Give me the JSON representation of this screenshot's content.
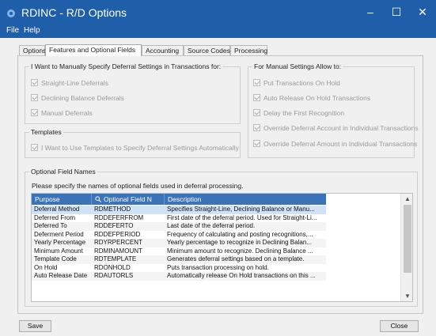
{
  "window": {
    "title": "RDINC - R/D Options",
    "controls": {
      "minimize": "–",
      "maximize": "☐",
      "close": "✕"
    }
  },
  "menu": [
    "File",
    "Help"
  ],
  "tabs": [
    "Options",
    "Features and Optional Fields",
    "Accounting",
    "Source Codes",
    "Processing"
  ],
  "active_tab": "Features and Optional Fields",
  "manual_group": {
    "title": "I Want to Manually Specify Deferral Settings in Transactions for:",
    "items": [
      "Straight-Line Deferrals",
      "Declining Balance Deferrals",
      "Manual Deferrals"
    ]
  },
  "templates_group": {
    "title": "Templates",
    "items": [
      "I Want to Use Templates to Specify Deferral Settings Automatically"
    ]
  },
  "allow_group": {
    "title": "For Manual Settings Allow to:",
    "items": [
      "Put Transactions On Hold",
      "Auto Release On Hold Transactions",
      "Delay the First Recognition",
      "Override Deferral Account in Individual Transactions",
      "Override Deferral Amount in Individual Transactions"
    ]
  },
  "optional_fields": {
    "title": "Optional Field Names",
    "intro": "Please specify the names of optional fields used in deferral processing.",
    "columns": [
      "Purpose",
      "Optional Field N",
      "Description"
    ],
    "rows": [
      [
        "Deferral Method",
        "RDMETHOD",
        "Specifies Straight-Line, Declining Balance or Manu..."
      ],
      [
        "Deferred From",
        "RDDEFERFROM",
        "First date of the deferral period. Used for Straight-Li..."
      ],
      [
        "Deferred To",
        "RDDEFERTO",
        "Last date of the deferral period."
      ],
      [
        "Deferment Period",
        "RDDEFPERIOD",
        "Frequency of calculating and posting recognitions,..."
      ],
      [
        "Yearly Percentage",
        "RDYRPERCENT",
        "Yearly percentage to recognize in Declining Balan..."
      ],
      [
        "Minimum Amount",
        "RDMINAMOUNT",
        "Minimum amount to recognize. Declining Balance ..."
      ],
      [
        "Template Code",
        "RDTEMPLATE",
        "Generates deferral settings based on a template."
      ],
      [
        "On Hold",
        "RDONHOLD",
        "Puts transaction processing on hold."
      ],
      [
        "Auto Release Date",
        "RDAUTORLS",
        "Automatically release On Hold transactions on this ..."
      ]
    ],
    "selected_row": 0
  },
  "buttons": {
    "save": "Save",
    "close": "Close"
  },
  "icons": {
    "app": "gear-icon",
    "column_search": "search-icon",
    "scroll_up": "▲",
    "scroll_down": "▼"
  },
  "colors": {
    "titlebar": "#1f5ea8",
    "grid_header": "#3b73b9",
    "selected_row": "#cfe2f6"
  }
}
